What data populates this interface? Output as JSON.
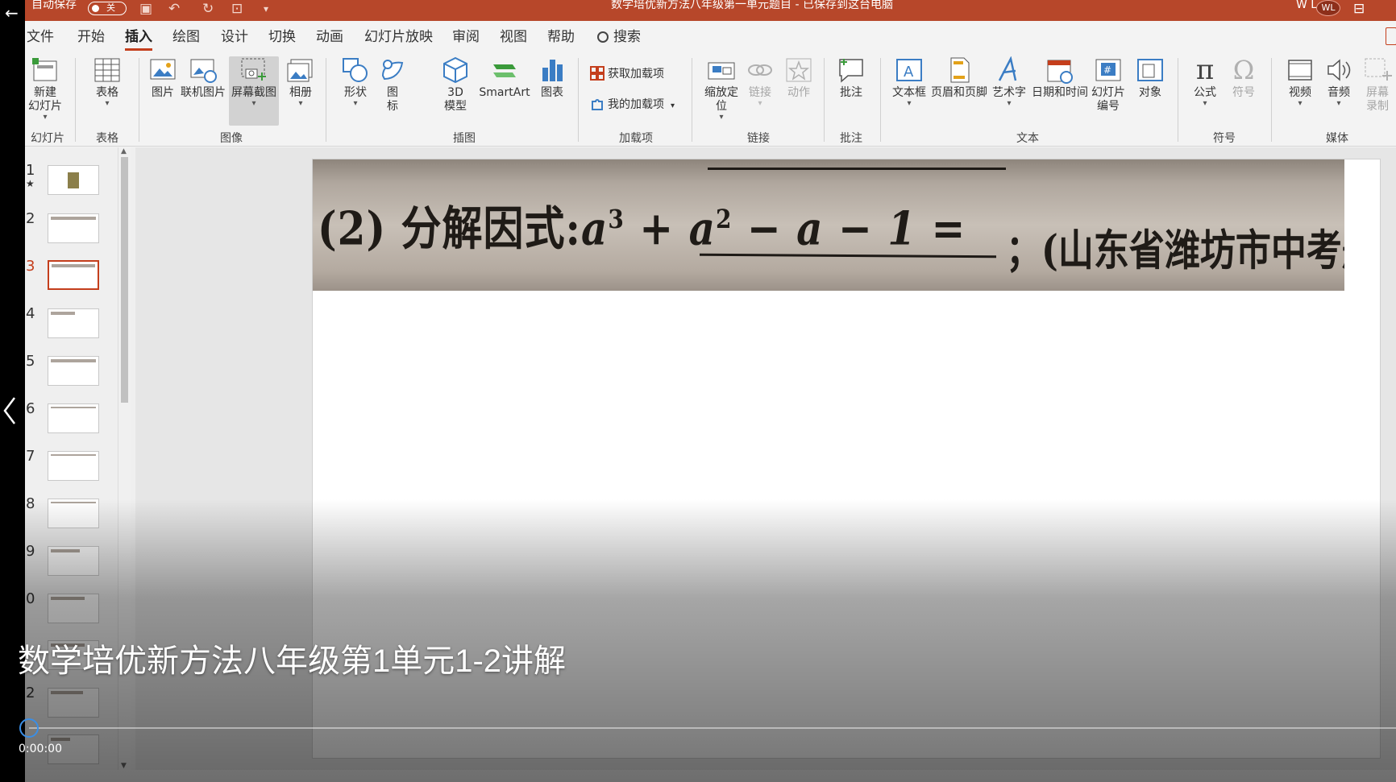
{
  "titlebar": {
    "autosave_label": "自动保存",
    "autosave_state": "关",
    "title": "数学培优新方法八年级第一单元题目 - 已保存到这台电脑",
    "user_initials": "W L",
    "avatar": "WL",
    "color": "#b7472a"
  },
  "tabs": [
    {
      "label": "文件"
    },
    {
      "label": "开始"
    },
    {
      "label": "插入",
      "active": true
    },
    {
      "label": "绘图"
    },
    {
      "label": "设计"
    },
    {
      "label": "切换"
    },
    {
      "label": "动画"
    },
    {
      "label": "幻灯片放映"
    },
    {
      "label": "审阅"
    },
    {
      "label": "视图"
    },
    {
      "label": "帮助"
    }
  ],
  "search": {
    "label": "搜索",
    "icon": "search-icon"
  },
  "ribbon": {
    "new_slide": "新建\n幻灯片",
    "table": "表格",
    "picture": "图片",
    "online_picture": "联机图片",
    "screenshot": "屏幕截图",
    "album": "相册",
    "shapes": "形状",
    "icons": "图\n标",
    "model3d": "3D\n模型",
    "smartart": "SmartArt",
    "chart": "图表",
    "get_addins": "获取加载项",
    "my_addins": "我的加载项",
    "zoom": "缩放定\n位",
    "link": "链接",
    "action": "动作",
    "comment": "批注",
    "textbox": "文本框",
    "header_footer": "页眉和页脚",
    "wordart": "艺术字",
    "datetime": "日期和时间",
    "slide_number": "幻灯片\n编号",
    "object": "对象",
    "equation": "公式",
    "symbol": "符号",
    "video": "视频",
    "audio": "音频",
    "screen_record": "屏幕\n录制",
    "groups": {
      "slides": "幻灯片",
      "tables": "表格",
      "images": "图像",
      "illustrations": "插图",
      "addins": "加载项",
      "links": "链接",
      "comments": "批注",
      "text": "文本",
      "symbols": "符号",
      "media": "媒体"
    }
  },
  "thumbnails": {
    "numbers": [
      "1",
      "2",
      "3",
      "4",
      "5",
      "6",
      "7",
      "8",
      "9",
      "0",
      "2"
    ],
    "selected": "3",
    "star": "★"
  },
  "slide": {
    "problem_label": "(2) 分解因式:",
    "expr_a": "a",
    "exp3": "3",
    "plus_a": " + a",
    "exp2": "2",
    "rest": " − a − 1 =",
    "source": "；(山东省潍坊市中考题)"
  },
  "video": {
    "title": "数学培优新方法八年级第1单元1-2讲解",
    "time": "0:00:00",
    "progress": 0
  }
}
